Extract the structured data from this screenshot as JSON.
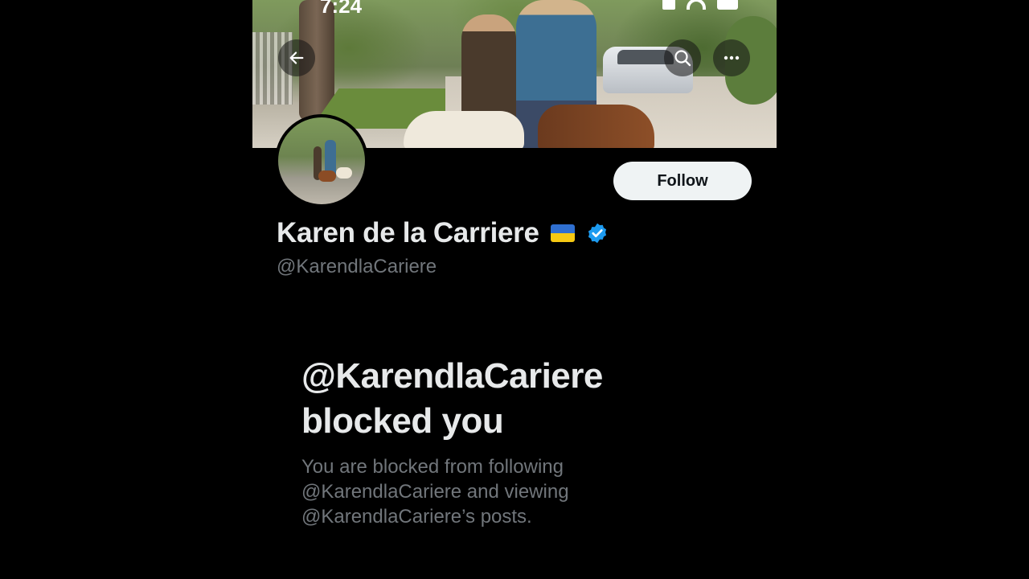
{
  "status_bar": {
    "time": "7:24"
  },
  "header": {
    "back_icon": "arrow-left-icon",
    "search_icon": "search-icon",
    "more_icon": "more-horizontal-icon"
  },
  "profile": {
    "display_name": "Karen de la Carriere",
    "flag_emoji": "ukraine-flag",
    "verified": true,
    "verified_color": "#1d9bf0",
    "handle": "@KarendlaCariere",
    "follow_label": "Follow"
  },
  "blocked_notice": {
    "title_line1": "@KarendlaCariere",
    "title_line2": "blocked you",
    "description_line1": "You are blocked from following",
    "description_line2": "@KarendlaCariere and viewing",
    "description_line3": "@KarendlaCariere’s posts."
  },
  "colors": {
    "background": "#000000",
    "primary_text": "#e7e9ea",
    "secondary_text": "#71767b",
    "follow_button_bg": "#eff3f4"
  }
}
